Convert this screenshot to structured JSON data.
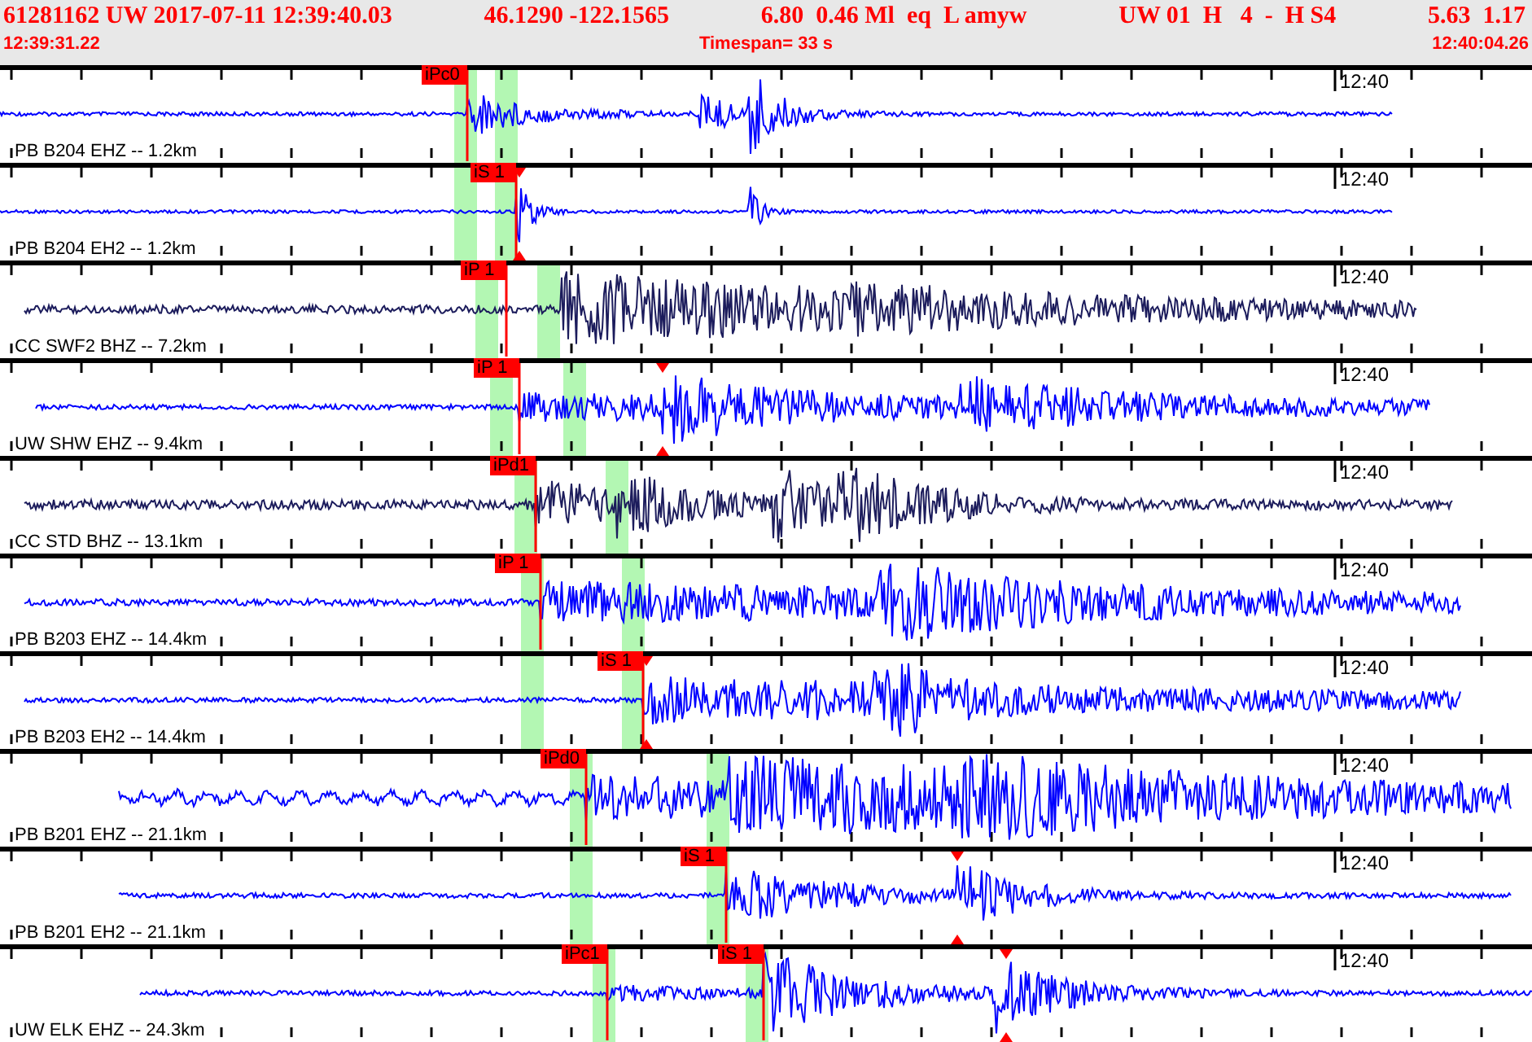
{
  "header": {
    "summary": [
      "61281162 UW 2017-07-11 12:39:40.03",
      "46.1290 -122.1565",
      "6.80  0.46 Ml  eq  L amyw",
      "UW 01  H   4  -  H S4",
      "5.63  1.17"
    ],
    "start_time": "12:39:31.22",
    "timespan": "Timespan=  33 s",
    "end_time": "12:40:04.26"
  },
  "traces": [
    {
      "station": "PB B204 EHZ -- 1.2km",
      "color": "#0000ff",
      "time_label": "12:40",
      "picks": [
        {
          "label": "iPc0"
        }
      ]
    },
    {
      "station": "PB B204 EH2 -- 1.2km",
      "color": "#0000ff",
      "time_label": "12:40",
      "picks": [
        {
          "label": "iS 1"
        }
      ]
    },
    {
      "station": "CC SWF2 BHZ -- 7.2km",
      "color": "#1c1c5c",
      "time_label": "12:40",
      "picks": [
        {
          "label": "iP 1"
        }
      ]
    },
    {
      "station": "UW SHW EHZ -- 9.4km",
      "color": "#0000ff",
      "time_label": "12:40",
      "picks": [
        {
          "label": "iP 1"
        }
      ]
    },
    {
      "station": "CC STD BHZ -- 13.1km",
      "color": "#1c1c5c",
      "time_label": "12:40",
      "picks": [
        {
          "label": "iPd1"
        }
      ]
    },
    {
      "station": "PB B203 EHZ -- 14.4km",
      "color": "#0000ff",
      "time_label": "12:40",
      "picks": [
        {
          "label": "iP 1"
        }
      ]
    },
    {
      "station": "PB B203 EH2 -- 14.4km",
      "color": "#0000ff",
      "time_label": "12:40",
      "picks": [
        {
          "label": "iS 1"
        }
      ]
    },
    {
      "station": "PB B201 EHZ -- 21.1km",
      "color": "#0000ff",
      "time_label": "12:40",
      "picks": [
        {
          "label": "iPd0"
        }
      ]
    },
    {
      "station": "PB B201 EH2 -- 21.1km",
      "color": "#0000ff",
      "time_label": "12:40",
      "picks": [
        {
          "label": "iS 1"
        }
      ]
    },
    {
      "station": "UW ELK EHZ -- 24.3km",
      "color": "#0000ff",
      "time_label": "12:40",
      "picks": [
        {
          "label": "iPc1"
        },
        {
          "label": "iS 1"
        }
      ]
    }
  ]
}
